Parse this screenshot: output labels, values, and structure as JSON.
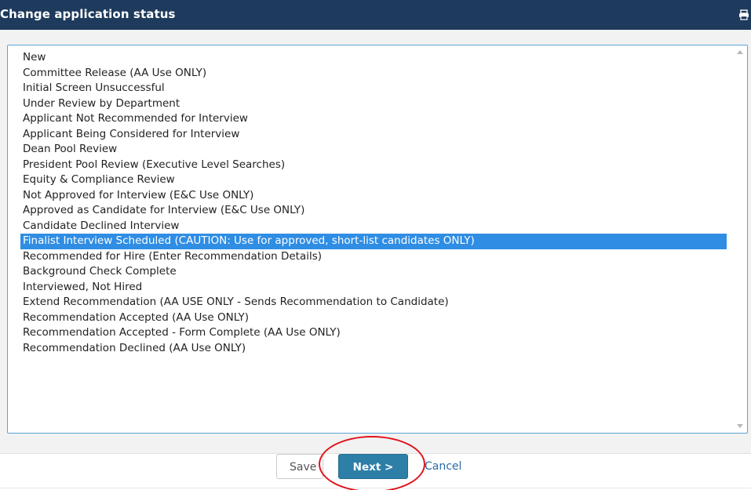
{
  "dialog": {
    "title": "Change application status",
    "print_icon": "print-icon",
    "colors": {
      "header_bg": "#1e3a5c",
      "selected_bg": "#2f8de4",
      "primary_button": "#2d7fa8",
      "annotation": "#e0141c"
    }
  },
  "status_list": {
    "selected_index": 12,
    "options": [
      "New",
      "Committee Release (AA Use ONLY)",
      "Initial Screen Unsuccessful",
      "Under Review by Department",
      "Applicant Not Recommended for Interview",
      "Applicant Being Considered for Interview",
      "Dean Pool Review",
      "President Pool Review (Executive Level Searches)",
      "Equity & Compliance Review",
      "Not Approved for Interview (E&C Use ONLY)",
      "Approved as Candidate for Interview (E&C Use ONLY)",
      "Candidate Declined Interview",
      "Finalist Interview Scheduled (CAUTION: Use for approved, short-list candidates ONLY)",
      "Recommended for Hire (Enter Recommendation Details)",
      "Background Check Complete",
      "Interviewed, Not Hired",
      "Extend Recommendation (AA USE ONLY - Sends Recommendation to Candidate)",
      "Recommendation Accepted (AA Use ONLY)",
      "Recommendation Accepted - Form Complete (AA Use ONLY)",
      "Recommendation Declined (AA Use ONLY)"
    ]
  },
  "footer": {
    "save_label": "Save",
    "next_label": "Next >",
    "cancel_label": "Cancel"
  }
}
